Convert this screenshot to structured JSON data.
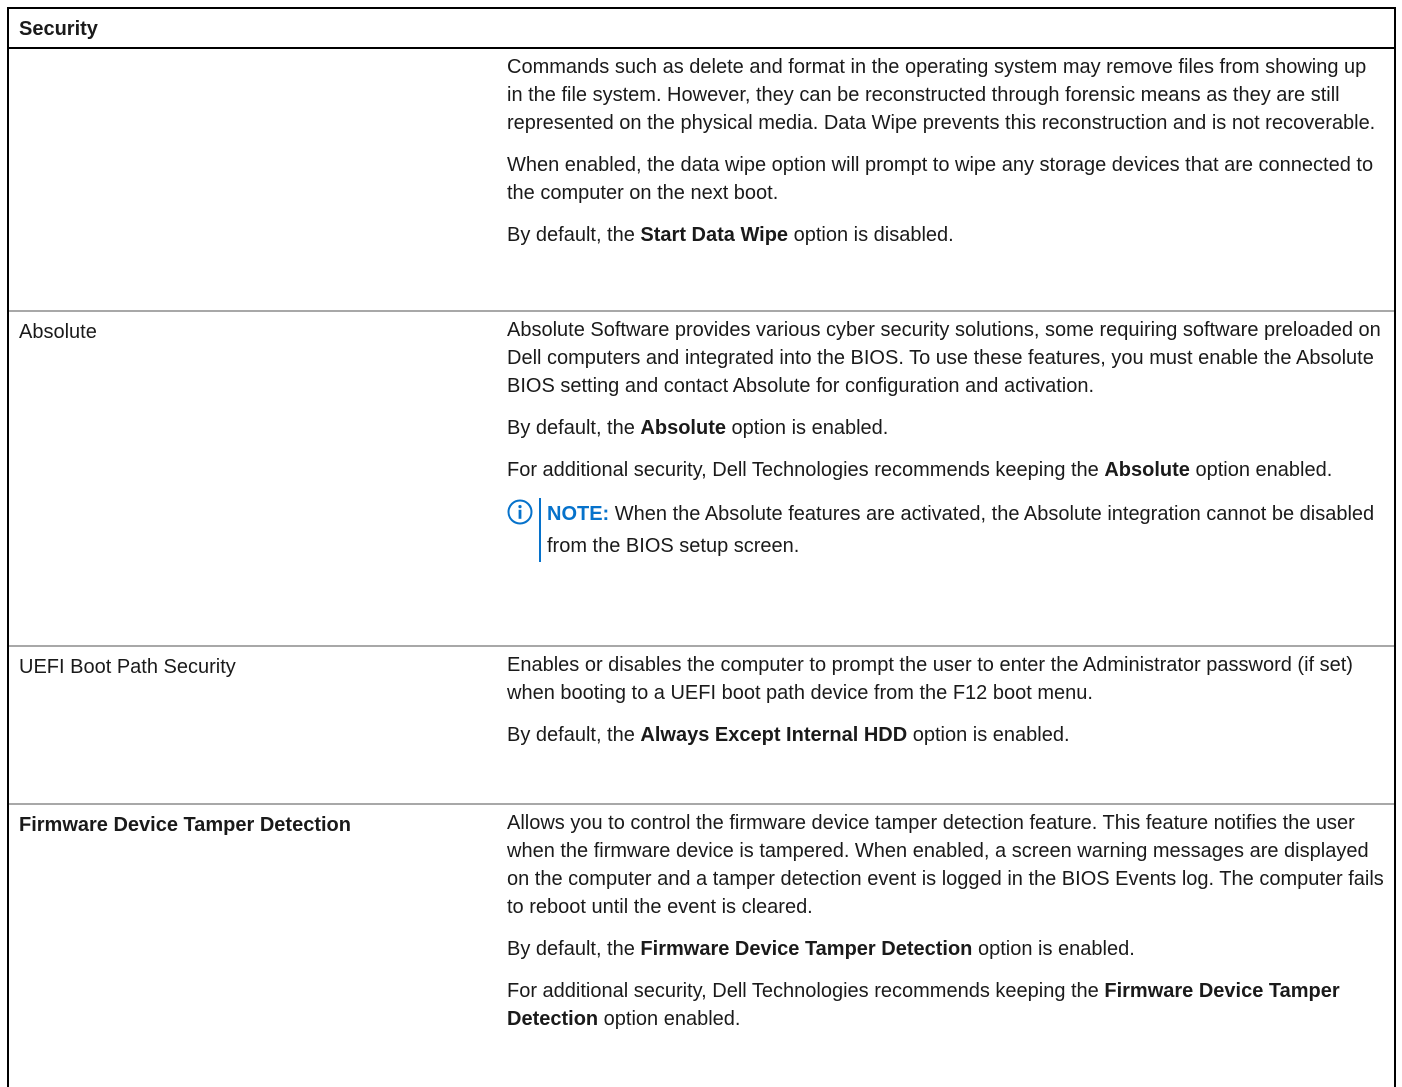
{
  "table": {
    "header": "Security",
    "rows": [
      {
        "setting": "",
        "paragraphs": [
          "Commands such as delete and format in the operating system may remove files from showing up in the file system. However, they can be reconstructed through forensic means as they are still represented on the physical media. Data Wipe prevents this reconstruction and is not recoverable.",
          "When enabled, the data wipe option will prompt to wipe any storage devices that are connected to the computer on the next boot."
        ],
        "default": {
          "pre": "By default, the ",
          "bold": "Start Data Wipe",
          "post": " option is disabled."
        }
      },
      {
        "setting": "Absolute",
        "paragraphs": [
          "Absolute Software provides various cyber security solutions, some requiring software preloaded on Dell computers and integrated into the BIOS. To use these features, you must enable the Absolute BIOS setting and contact Absolute for configuration and activation."
        ],
        "default": {
          "pre": "By default, the ",
          "bold": "Absolute",
          "post": " option is enabled."
        },
        "recommend": {
          "pre": "For additional security, Dell Technologies recommends keeping the ",
          "bold": "Absolute",
          "post": " option enabled."
        },
        "note": {
          "label": "NOTE:",
          "icon": "info-icon",
          "text": " When the Absolute features are activated, the Absolute integration cannot be disabled from the BIOS setup screen."
        }
      },
      {
        "setting": "UEFI Boot Path Security",
        "paragraphs": [
          "Enables or disables the computer to prompt the user to enter the Administrator password (if set) when booting to a UEFI boot path device from the F12 boot menu."
        ],
        "default": {
          "pre": "By default, the ",
          "bold": "Always Except Internal HDD",
          "post": " option is enabled."
        }
      },
      {
        "setting": "Firmware Device Tamper Detection",
        "paragraphs": [
          "Allows you to control the firmware device tamper detection feature. This feature notifies the user when the firmware device is tampered. When enabled, a screen warning messages are displayed on the computer and a tamper detection event is logged in the BIOS Events log. The computer fails to reboot until the event is cleared."
        ],
        "default": {
          "pre": "By default, the ",
          "bold": "Firmware Device Tamper Detection",
          "post": " option is enabled."
        },
        "recommend": {
          "pre": "For additional security, Dell Technologies recommends keeping the ",
          "bold": "Firmware Device Tamper Detection",
          "post": " option enabled."
        }
      }
    ]
  },
  "colors": {
    "note_accent": "#0672cb",
    "row_divider": "#a8a8a8",
    "frame": "#000000"
  }
}
